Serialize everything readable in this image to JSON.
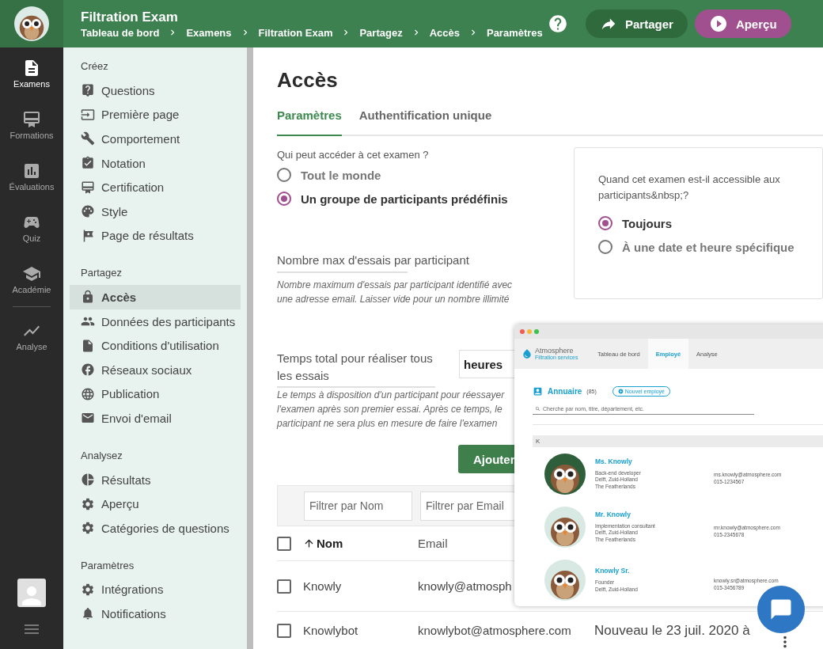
{
  "header": {
    "title": "Filtration Exam",
    "breadcrumbs": [
      "Tableau de bord",
      "Examens",
      "Filtration Exam",
      "Partagez",
      "Accès",
      "Paramètres"
    ],
    "share_button": "Partager",
    "preview_button": "Aperçu"
  },
  "rail": {
    "items": [
      {
        "label": "Examens",
        "selected": true
      },
      {
        "label": "Formations",
        "selected": false
      },
      {
        "label": "Évaluations",
        "selected": false
      },
      {
        "label": "Quiz",
        "selected": false
      },
      {
        "label": "Académie",
        "selected": false
      },
      {
        "label": "Analyse",
        "selected": false
      }
    ]
  },
  "sidebar": {
    "sections": [
      {
        "title": "Créez",
        "items": [
          {
            "label": "Questions",
            "selected": false
          },
          {
            "label": "Première page",
            "selected": false
          },
          {
            "label": "Comportement",
            "selected": false
          },
          {
            "label": "Notation",
            "selected": false
          },
          {
            "label": "Certification",
            "selected": false
          },
          {
            "label": "Style",
            "selected": false
          },
          {
            "label": "Page de résultats",
            "selected": false
          }
        ]
      },
      {
        "title": "Partagez",
        "items": [
          {
            "label": "Accès",
            "selected": true
          },
          {
            "label": "Données des participants",
            "selected": false
          },
          {
            "label": "Conditions d'utilisation",
            "selected": false
          },
          {
            "label": "Réseaux sociaux",
            "selected": false
          },
          {
            "label": "Publication",
            "selected": false
          },
          {
            "label": "Envoi d'email",
            "selected": false
          }
        ]
      },
      {
        "title": "Analysez",
        "items": [
          {
            "label": "Résultats",
            "selected": false
          },
          {
            "label": "Aperçu",
            "selected": false
          },
          {
            "label": "Catégories de questions",
            "selected": false
          }
        ]
      },
      {
        "title": "Paramètres",
        "items": [
          {
            "label": "Intégrations",
            "selected": false
          },
          {
            "label": "Notifications",
            "selected": false
          }
        ]
      }
    ]
  },
  "page": {
    "title": "Accès",
    "tabs": [
      {
        "label": "Paramètres",
        "selected": true
      },
      {
        "label": "Authentification unique",
        "selected": false
      }
    ],
    "access": {
      "question": "Qui peut accéder à cet examen ?",
      "options": [
        {
          "label": "Tout le monde",
          "selected": false
        },
        {
          "label": "Un groupe de participants prédéfinis",
          "selected": true
        }
      ]
    },
    "availability": {
      "question": "Quand cet examen est-il accessible aux participants&nbsp;?",
      "options": [
        {
          "label": "Toujours",
          "selected": true
        },
        {
          "label": "À une date et heure spécifique",
          "selected": false
        }
      ]
    },
    "max_attempts": {
      "label": "Nombre max d'essais par participant",
      "hint": "Nombre maximum d'essais par participant identifié avec une adresse email. Laisser vide pour un nombre illimité"
    },
    "total_time": {
      "label": "Temps total pour réaliser tous les essais",
      "unit": "heures",
      "hint": "Le temps à disposition d'un participant pour réessayer l'examen après son premier essai. Après ce temps, le participant ne sera plus en mesure de faire l'examen"
    },
    "add_button": "Ajouter",
    "filters": [
      {
        "placeholder": "Filtrer par Nom"
      },
      {
        "placeholder": "Filtrer par Email"
      }
    ],
    "table": {
      "select_all": {
        "checked": false
      },
      "columns": [
        "Nom",
        "Email"
      ],
      "rows": [
        {
          "checked": false,
          "name": "Knowly",
          "email": "knowly@atmosph"
        },
        {
          "checked": false,
          "name": "Knowlybot",
          "email": "knowlybot@atmosphere.com",
          "column_3": "Nouveau le 23 juil. 2020 à"
        }
      ]
    }
  },
  "overlay": {
    "brand": "Atmosphere",
    "brand_tagline": "Filtration services",
    "tabs": [
      {
        "label": "Tableau de bord",
        "selected": false
      },
      {
        "label": "Employé",
        "selected": true
      },
      {
        "label": "Analyse",
        "selected": false
      }
    ],
    "directory_title": "Annuaire",
    "count": "(85)",
    "new_button": "Nouvel employé",
    "search": {
      "placeholder": "Cherche par nom, titre, département, etc."
    },
    "group_letter": "K",
    "employees": [
      {
        "name": "Ms. Knowly",
        "title": "Back-end developer",
        "city": "Delft, Zuid-Holland",
        "country": "The Featherlands",
        "email": "ms.knowly@atmosphere.com",
        "phone": "015-1234567"
      },
      {
        "name": "Mr. Knowly",
        "title": "Implementation consultant",
        "city": "Delft, Zuid-Holland",
        "country": "The Featherlands",
        "email": "mr.knowly@atmosphere.com",
        "phone": "015-2345678"
      },
      {
        "name": "Knowly Sr.",
        "title": "Founder",
        "city": "Delft, Zuid-Holland",
        "email": "knowly.sr@atmosphere.com",
        "phone": "015-3456789"
      }
    ]
  }
}
